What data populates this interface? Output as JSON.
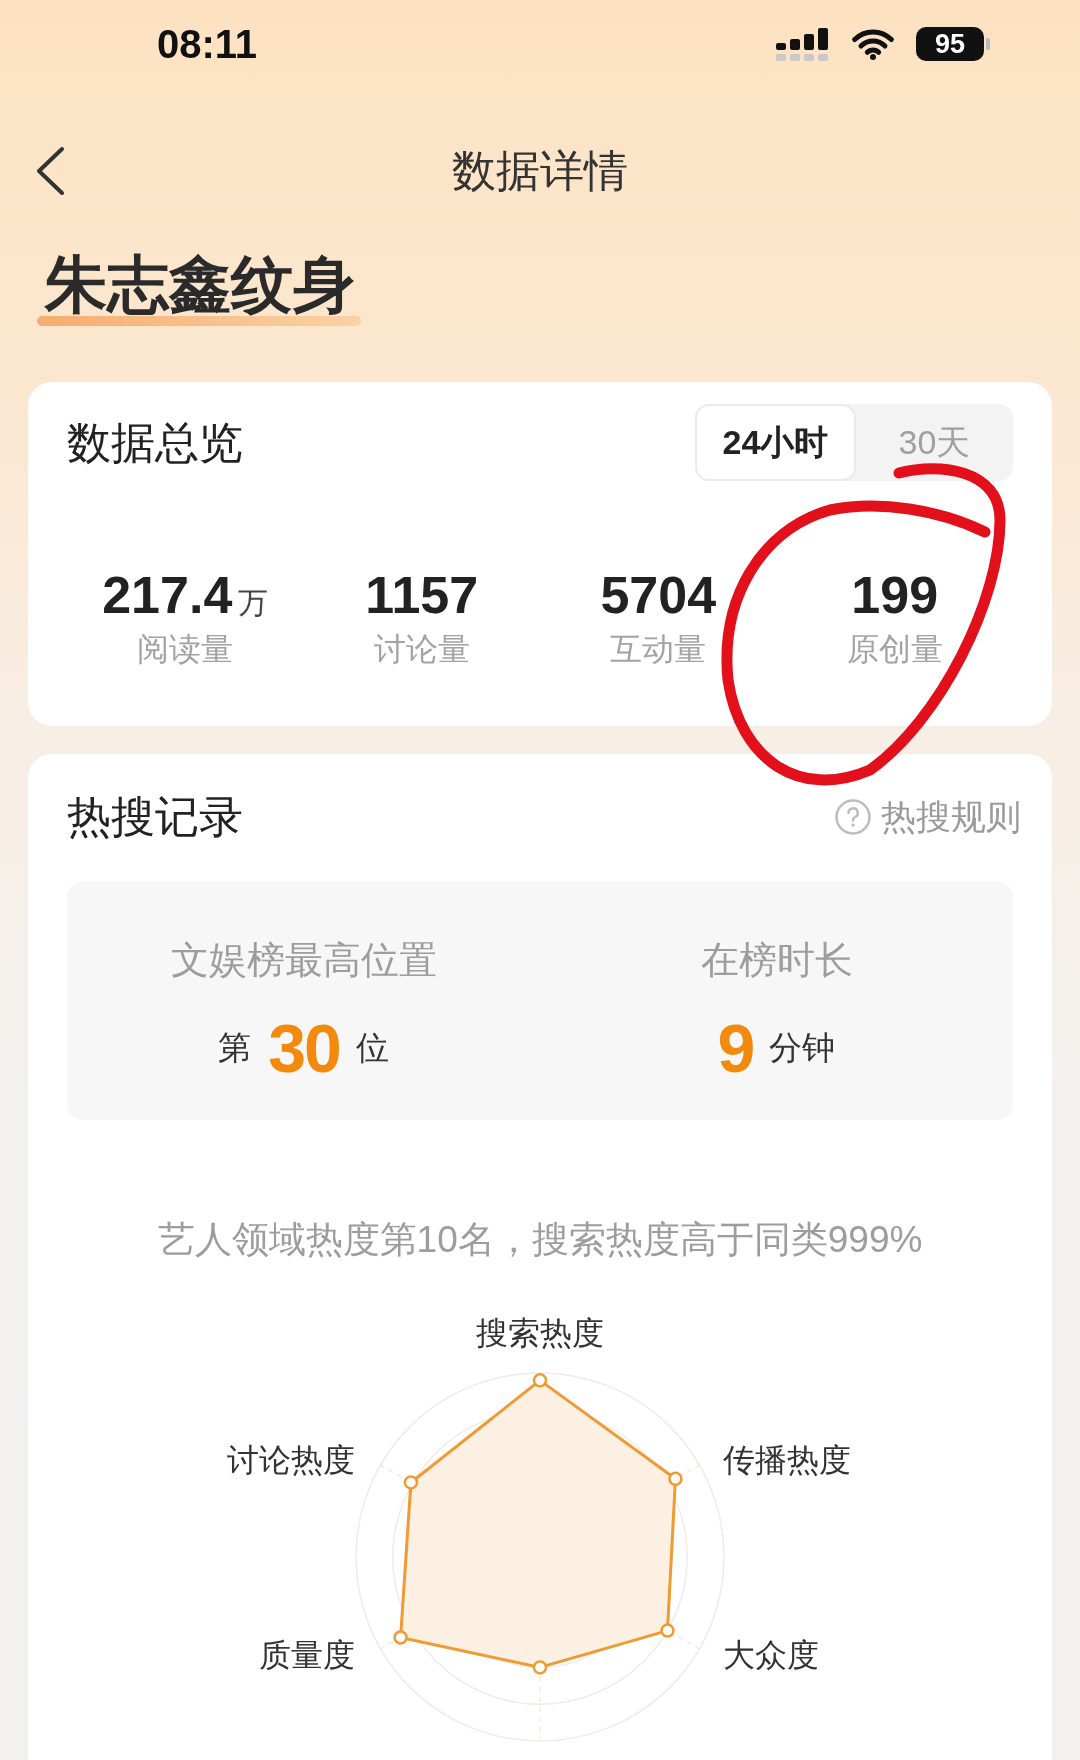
{
  "status_bar": {
    "time": "08:11",
    "battery": "95"
  },
  "nav": {
    "title": "数据详情"
  },
  "topic": {
    "title": "朱志鑫纹身"
  },
  "overview": {
    "title": "数据总览",
    "tabs": [
      {
        "label": "24小时",
        "selected": true
      },
      {
        "label": "30天",
        "selected": false
      }
    ],
    "stats": [
      {
        "value": "217.4",
        "unit": "万",
        "label": "阅读量"
      },
      {
        "value": "1157",
        "label": "讨论量"
      },
      {
        "value": "5704",
        "label": "互动量"
      },
      {
        "value": "199",
        "label": "原创量"
      }
    ]
  },
  "hot_search": {
    "title": "热搜记录",
    "rules_link": "热搜规则",
    "records": [
      {
        "label": "文娱榜最高位置",
        "prefix": "第",
        "value": "30",
        "suffix": "位"
      },
      {
        "label": "在榜时长",
        "value": "9",
        "suffix": "分钟"
      }
    ],
    "summary": "艺人领域热度第10名，搜索热度高于同类999%",
    "radar": {
      "labels": [
        "搜索热度",
        "传播热度",
        "大众度",
        "质量度",
        "讨论热度"
      ]
    }
  }
}
